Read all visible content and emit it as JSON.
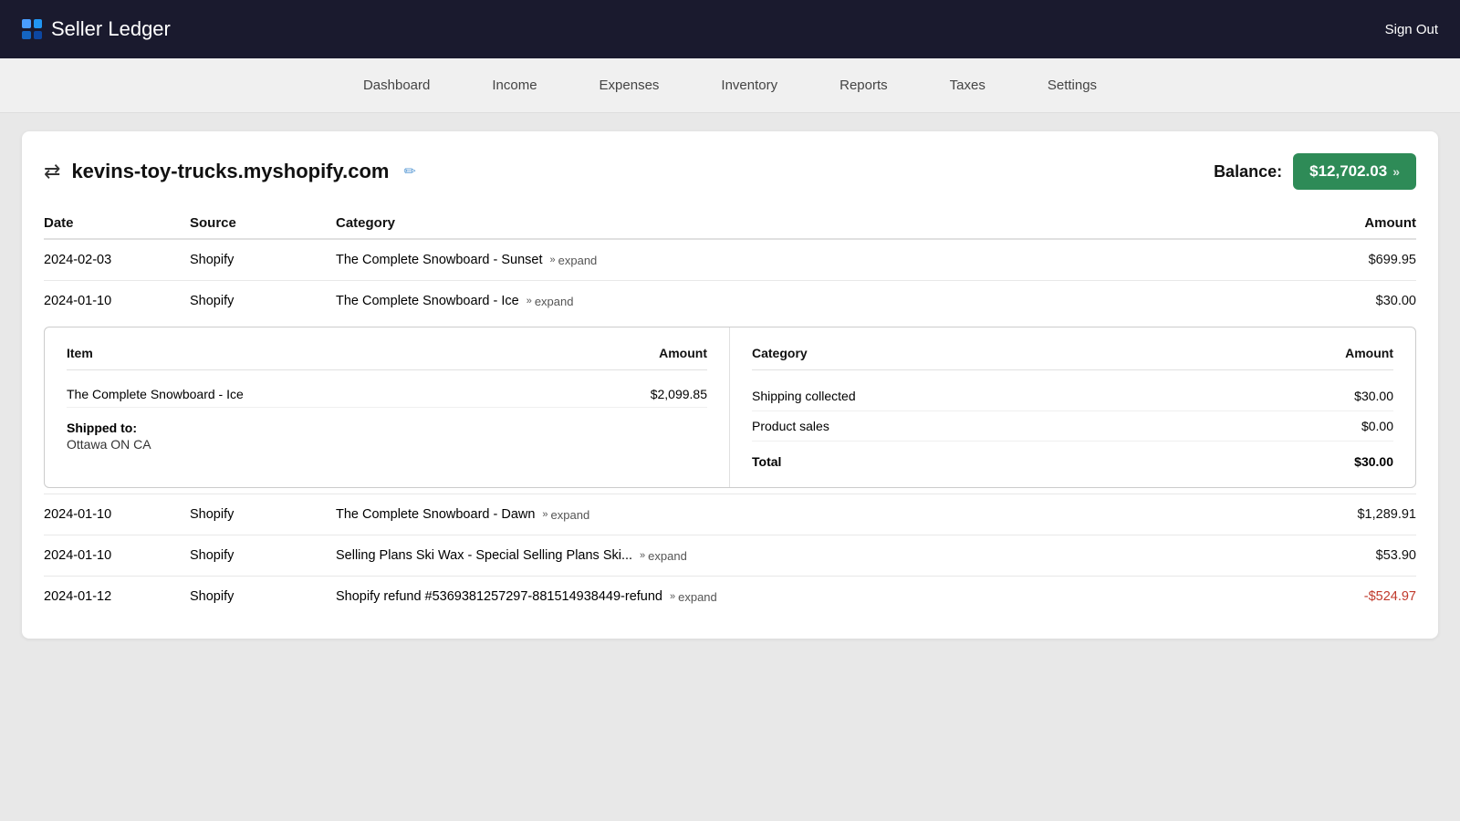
{
  "app": {
    "name": "Seller Ledger",
    "sign_out_label": "Sign Out"
  },
  "nav": {
    "items": [
      {
        "label": "Dashboard",
        "id": "dashboard"
      },
      {
        "label": "Income",
        "id": "income"
      },
      {
        "label": "Expenses",
        "id": "expenses"
      },
      {
        "label": "Inventory",
        "id": "inventory"
      },
      {
        "label": "Reports",
        "id": "reports"
      },
      {
        "label": "Taxes",
        "id": "taxes"
      },
      {
        "label": "Settings",
        "id": "settings"
      }
    ]
  },
  "page": {
    "store_name": "kevins-toy-trucks.myshopify.com",
    "balance_label": "Balance:",
    "balance_value": "$12,702.03",
    "columns": {
      "date": "Date",
      "source": "Source",
      "category": "Category",
      "amount": "Amount"
    }
  },
  "rows": [
    {
      "date": "2024-02-03",
      "source": "Shopify",
      "category": "The Complete Snowboard - Sunset",
      "expand_label": "expand",
      "amount": "$699.95",
      "negative": false,
      "expanded": false
    },
    {
      "date": "2024-01-10",
      "source": "Shopify",
      "category": "The Complete Snowboard - Ice",
      "expand_label": "expand",
      "amount": "$30.00",
      "negative": false,
      "expanded": true,
      "detail": {
        "left": {
          "item_header": "Item",
          "amount_header": "Amount",
          "items": [
            {
              "name": "The Complete Snowboard - Ice",
              "amount": "$2,099.85"
            }
          ],
          "shipped_label": "Shipped to:",
          "shipped_address": "Ottawa ON CA"
        },
        "right": {
          "category_header": "Category",
          "amount_header": "Amount",
          "categories": [
            {
              "name": "Shipping collected",
              "amount": "$30.00"
            },
            {
              "name": "Product sales",
              "amount": "$0.00"
            }
          ],
          "total_label": "Total",
          "total_amount": "$30.00"
        }
      }
    },
    {
      "date": "2024-01-10",
      "source": "Shopify",
      "category": "The Complete Snowboard - Dawn",
      "expand_label": "expand",
      "amount": "$1,289.91",
      "negative": false,
      "expanded": false
    },
    {
      "date": "2024-01-10",
      "source": "Shopify",
      "category": "Selling Plans Ski Wax - Special Selling Plans Ski...",
      "expand_label": "expand",
      "amount": "$53.90",
      "negative": false,
      "expanded": false
    },
    {
      "date": "2024-01-12",
      "source": "Shopify",
      "category": "Shopify refund #5369381257297-881514938449-refund",
      "expand_label": "expand",
      "amount": "-$524.97",
      "negative": true,
      "expanded": false
    }
  ]
}
